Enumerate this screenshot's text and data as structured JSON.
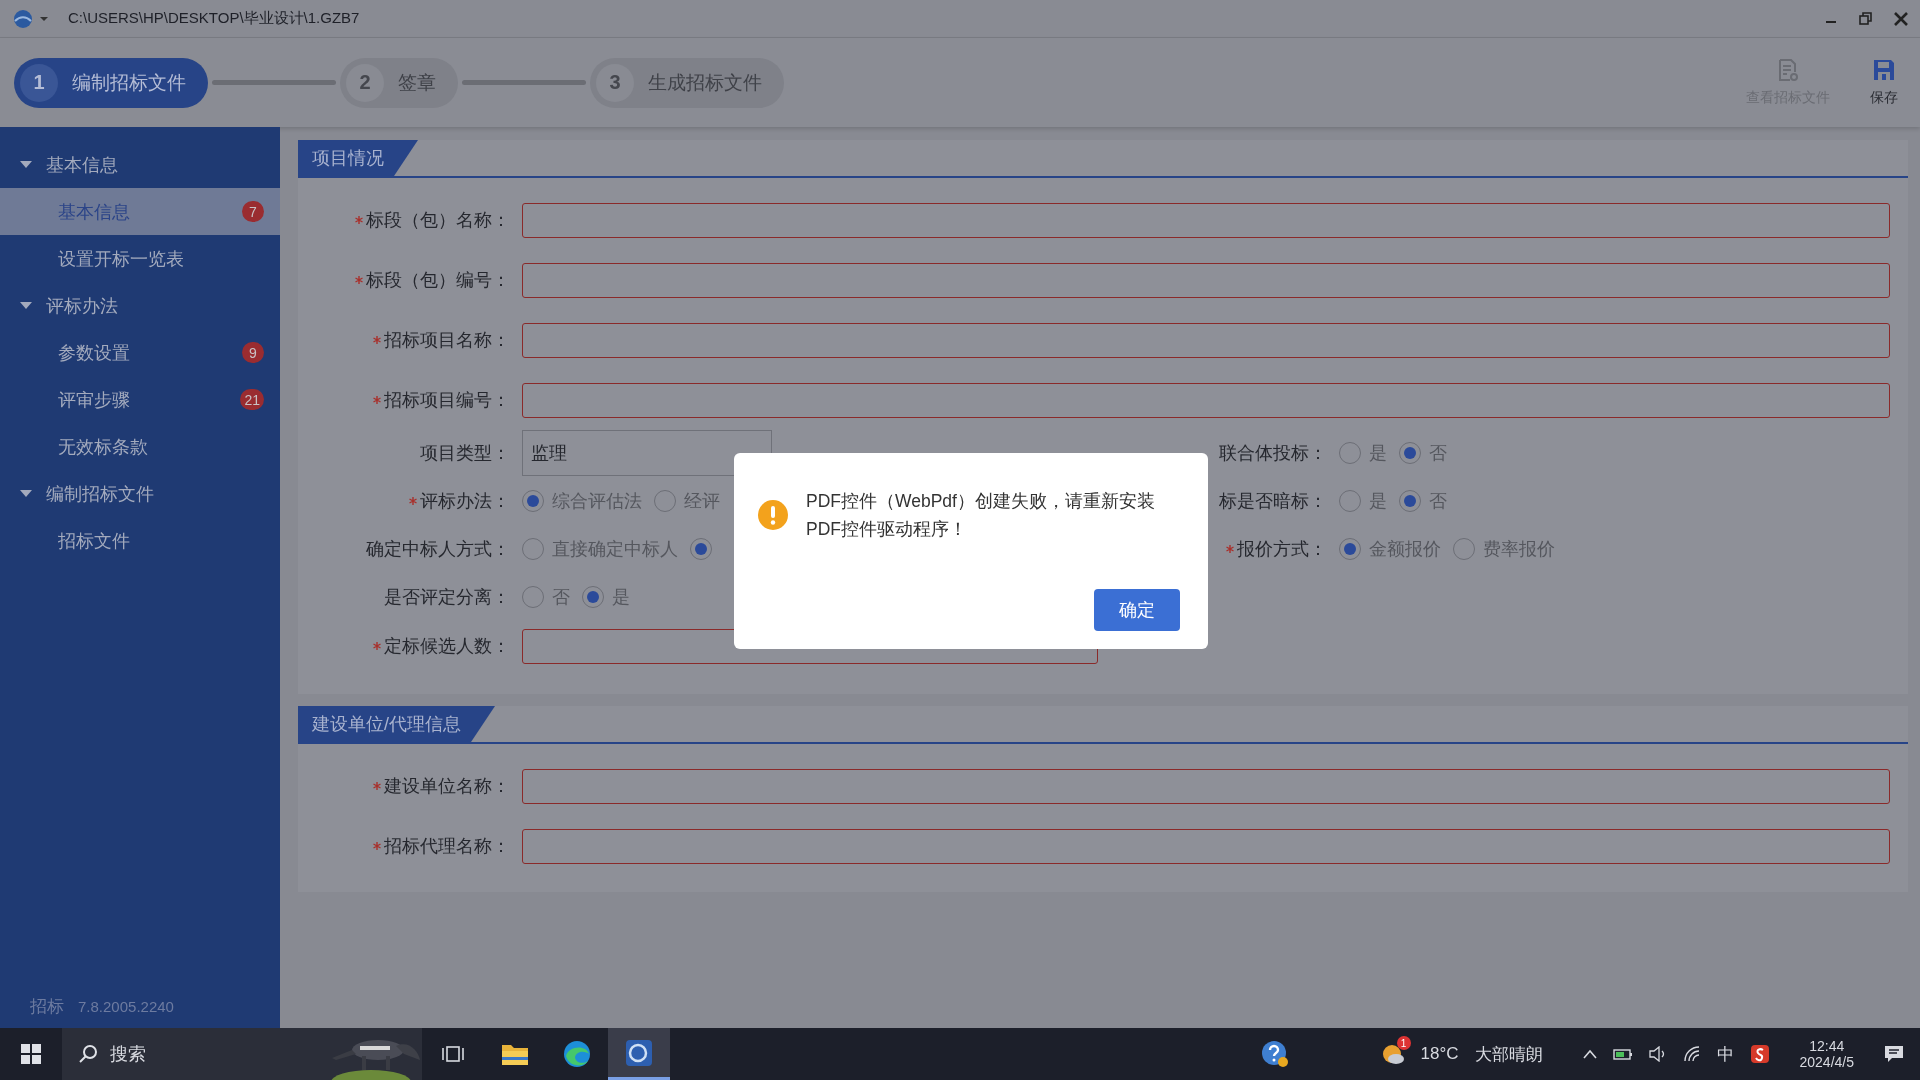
{
  "window": {
    "title": "C:\\USERS\\HP\\DESKTOP\\毕业设计\\1.GZB7"
  },
  "steps": [
    {
      "number": "1",
      "label": "编制招标文件",
      "selected": true
    },
    {
      "number": "2",
      "label": "签章",
      "selected": false
    },
    {
      "number": "3",
      "label": "生成招标文件",
      "selected": false
    }
  ],
  "toolbar": [
    {
      "kind": "document",
      "label": "查看招标文件",
      "disabled": true
    },
    {
      "kind": "save",
      "label": "保存",
      "disabled": false
    }
  ],
  "sidebar": {
    "groups": [
      {
        "label": "基本信息",
        "expanded": true,
        "children": [
          {
            "label": "基本信息",
            "selected": true,
            "badge": "7"
          },
          {
            "label": "设置开标一览表",
            "selected": false
          }
        ]
      },
      {
        "label": "评标办法",
        "expanded": true,
        "children": [
          {
            "label": "参数设置",
            "selected": false,
            "badge": "9"
          },
          {
            "label": "评审步骤",
            "selected": false,
            "badge": "21"
          },
          {
            "label": "无效标条款",
            "selected": false
          }
        ]
      },
      {
        "label": "编制招标文件",
        "expanded": true,
        "children": [
          {
            "label": "招标文件",
            "selected": false
          }
        ]
      }
    ],
    "footer": {
      "product": "招标",
      "version": "7.8.2005.2240"
    }
  },
  "sections": [
    {
      "title": "项目情况",
      "fields": [
        {
          "kind": "text",
          "label": "标段（包）名称：",
          "required": true
        },
        {
          "kind": "text",
          "label": "标段（包）编号：",
          "required": true
        },
        {
          "kind": "text",
          "label": "招标项目名称：",
          "required": true
        },
        {
          "kind": "text",
          "label": "招标项目编号：",
          "required": true
        }
      ],
      "left_column": [
        {
          "kind": "select",
          "label": "项目类型：",
          "required": false,
          "value": "监理"
        },
        {
          "kind": "radio",
          "label": "评标办法：",
          "required": true,
          "options": [
            {
              "label": "综合评估法",
              "selected": true
            },
            {
              "label": "经评",
              "selected": false
            }
          ]
        },
        {
          "kind": "radio",
          "label": "确定中标人方式：",
          "required": false,
          "options": [
            {
              "label": "直接确定中标人",
              "selected": false
            },
            {
              "selected": true
            }
          ]
        },
        {
          "kind": "radio",
          "label": "是否评定分离：",
          "required": false,
          "options": [
            {
              "label": "否",
              "selected": false
            },
            {
              "label": "是",
              "selected": true
            }
          ]
        }
      ],
      "right_column": [
        {
          "kind": "radio",
          "label": "联合体投标：",
          "required": false,
          "options": [
            {
              "label": "是",
              "selected": false
            },
            {
              "label": "否",
              "selected": true
            }
          ]
        },
        {
          "kind": "radio",
          "label": "标是否暗标：",
          "required": false,
          "options": [
            {
              "label": "是",
              "selected": false
            },
            {
              "label": "否",
              "selected": true
            }
          ]
        },
        {
          "kind": "radio",
          "label": "报价方式：",
          "required": true,
          "options": [
            {
              "label": "金额报价",
              "selected": true
            },
            {
              "label": "费率报价",
              "selected": false
            }
          ]
        }
      ],
      "trailing_fields": [
        {
          "kind": "short_text",
          "label": "定标候选人数：",
          "required": true
        }
      ]
    },
    {
      "title": "建设单位/代理信息",
      "fields": [
        {
          "kind": "text",
          "label": "建设单位名称：",
          "required": true
        },
        {
          "kind": "text",
          "label": "招标代理名称：",
          "required": true
        }
      ]
    }
  ],
  "dialog": {
    "message_lines": [
      "PDF控件（WebPdf）创建失败，请重新安装",
      "PDF控件驱动程序！"
    ],
    "button": "确定"
  },
  "taskbar": {
    "search_placeholder": "搜索",
    "weather": {
      "badge": "1",
      "temperature": "18°C",
      "text": "大部晴朗"
    },
    "ime": "中",
    "time": "12:44",
    "date": "2024/4/5"
  }
}
